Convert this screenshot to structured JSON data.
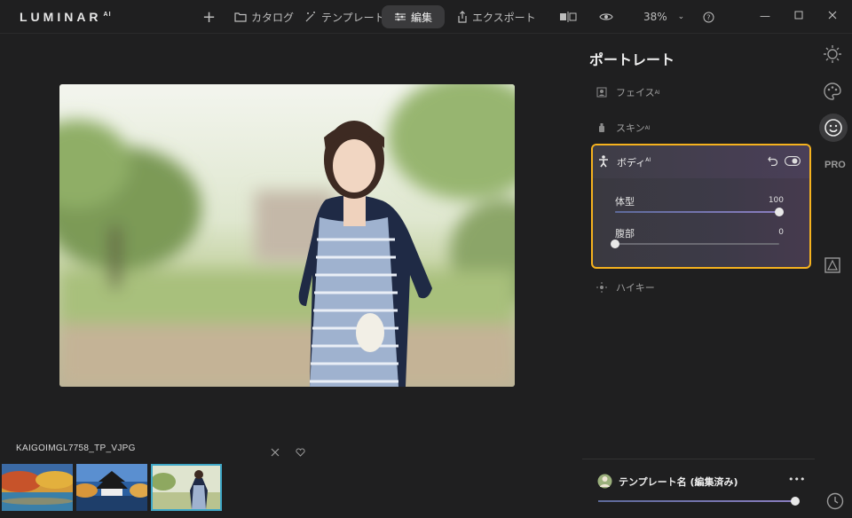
{
  "app": {
    "logo": "LUMINAR",
    "logo_sup": "AI"
  },
  "toolbar": {
    "catalog_label": "カタログ",
    "templates_label": "テンプレート",
    "edit_label": "編集",
    "export_label": "エクスポート",
    "zoom": "38%"
  },
  "file": {
    "name": "KAIGOIMGL7758_TP_VJPG"
  },
  "filmstrip": {
    "thumbs": [
      "autumn-lake",
      "castle",
      "portrait"
    ],
    "selected": 2
  },
  "panel": {
    "title": "ポートレート",
    "tools": [
      {
        "label": "フェイス",
        "ai": "AI"
      },
      {
        "label": "スキン",
        "ai": "AI"
      },
      {
        "label": "ボディ",
        "ai": "AI"
      },
      {
        "label": "ハイキー",
        "ai": ""
      }
    ],
    "body": {
      "sliders": [
        {
          "label": "体型",
          "value": "100",
          "fraction": 1.0
        },
        {
          "label": "腹部",
          "value": "0",
          "fraction": 0.0
        }
      ]
    },
    "side": {
      "pro": "PRO"
    }
  },
  "template": {
    "name": "テンプレート名 (編集済み)",
    "more": "•••"
  },
  "colors": {
    "accent": "#f5b21e",
    "selected_thumb": "#3fa7c7",
    "bg": "#1f1f20"
  }
}
